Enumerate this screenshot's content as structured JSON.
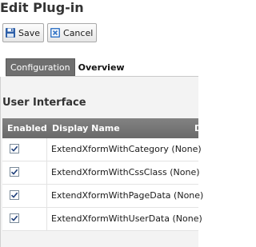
{
  "page": {
    "title": "Edit Plug-in"
  },
  "toolbar": {
    "save_label": "Save",
    "cancel_label": "Cancel"
  },
  "tabs": [
    {
      "label": "Configuration",
      "active": true
    },
    {
      "label": "Overview",
      "active": false
    }
  ],
  "section": {
    "heading": "User Interface"
  },
  "grid": {
    "columns": [
      "Enabled",
      "Display Name",
      "D"
    ],
    "rows": [
      {
        "enabled": true,
        "display_name": "ExtendXformWithCategory (None)"
      },
      {
        "enabled": true,
        "display_name": "ExtendXformWithCssClass (None)"
      },
      {
        "enabled": true,
        "display_name": "ExtendXformWithPageData (None)"
      },
      {
        "enabled": true,
        "display_name": "ExtendXformWithUserData (None)"
      }
    ]
  },
  "colors": {
    "header_bg": "#6f6f6f",
    "active_tab": "#6f6f6f",
    "panel_bg": "#f3f3f3"
  }
}
